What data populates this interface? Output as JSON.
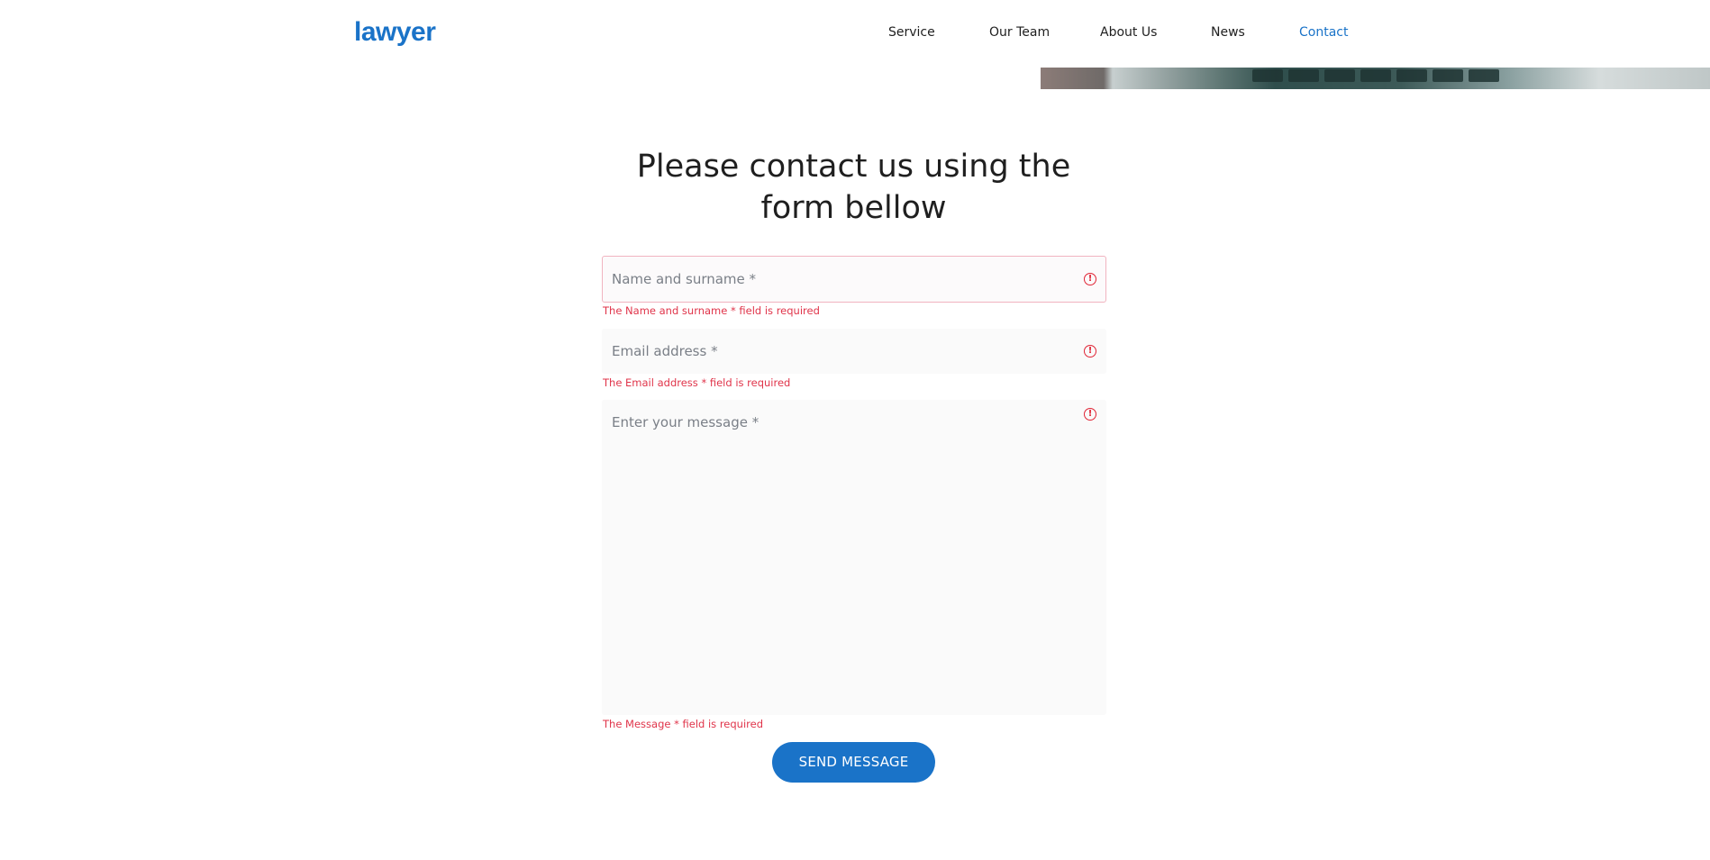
{
  "header": {
    "logo": "lawyer",
    "nav": [
      {
        "label": "Service",
        "active": false
      },
      {
        "label": "Our Team",
        "active": false
      },
      {
        "label": "About Us",
        "active": false
      },
      {
        "label": "News",
        "active": false
      },
      {
        "label": "Contact",
        "active": true
      }
    ]
  },
  "main": {
    "title_line1": "Please contact us using the",
    "title_line2": "form bellow"
  },
  "form": {
    "name": {
      "placeholder": "Name and surname *",
      "error": "The Name and surname * field is required"
    },
    "email": {
      "placeholder": "Email address *",
      "error": "The Email address * field is required"
    },
    "message": {
      "placeholder": "Enter your message *",
      "error": "The Message * field is required"
    },
    "error_icon": "!",
    "submit_label": "SEND MESSAGE"
  },
  "colors": {
    "accent": "#1a73c8",
    "error": "#e0344a"
  }
}
